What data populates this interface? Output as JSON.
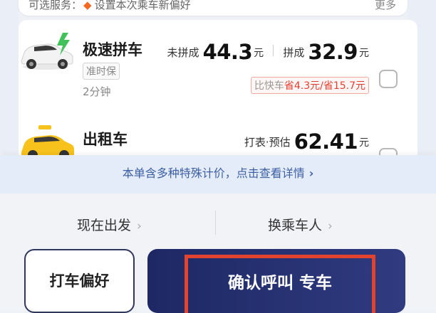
{
  "service_bar": {
    "label": "可选服务：",
    "text": "设置本次乘车新偏好",
    "more": "更多"
  },
  "options": [
    {
      "name": "极速拼车",
      "badge": "准时保",
      "eta": "2分钟",
      "price_unpooled_label": "未拼成",
      "price_unpooled": "44.3",
      "price_pooled_label": "拼成",
      "price_pooled": "32.9",
      "unit": "元",
      "saving_prefix": "比快车",
      "saving_value": "省4.3元/省15.7元",
      "icon": "car-green-electric-icon"
    },
    {
      "name": "出租车",
      "price_label": "打表·预估",
      "price": "62.41",
      "unit": "元",
      "icon": "taxi-car-icon"
    }
  ],
  "notice": {
    "text": "本单含多种特殊计价，点击查看详情",
    "chevron": "›"
  },
  "bottom": {
    "depart": "现在出发",
    "passenger": "换乘车人",
    "chevron": "›",
    "pref_button": "打车偏好",
    "confirm_button": "确认呼叫 专车"
  },
  "colors": {
    "accent": "#1d2864",
    "highlight": "#e2432e",
    "notice_text": "#3d5fa3"
  }
}
